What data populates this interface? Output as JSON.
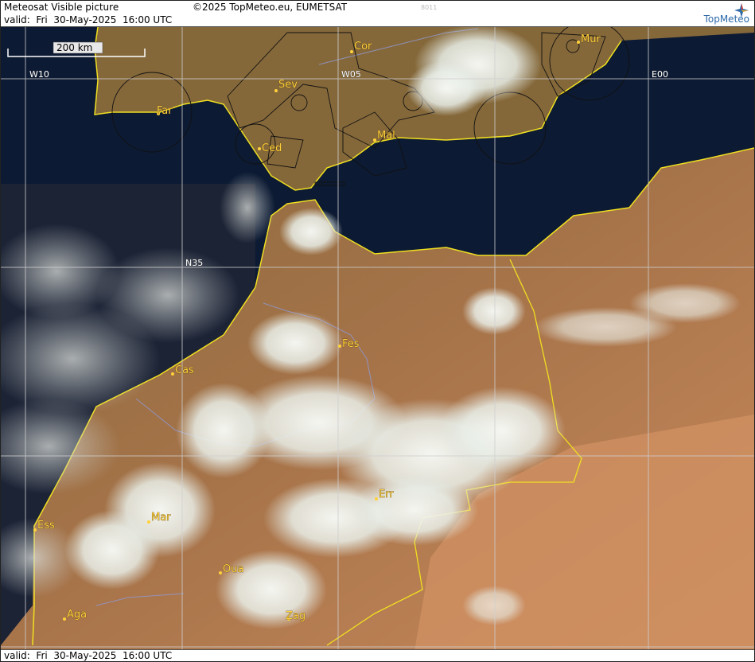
{
  "header": {
    "title": "Meteosat Visible picture",
    "copyright": "©2025 TopMeteo.eu, EUMETSAT",
    "frame_id": "8011",
    "valid": "valid:  Fri  30-May-2025  16:00 UTC",
    "logo": "TopMeteo"
  },
  "footer": {
    "valid": "valid:  Fri  30-May-2025  16:00 UTC"
  },
  "scale": {
    "label": "200 km"
  },
  "grid_labels": {
    "w10": "W10",
    "w05": "W05",
    "e00": "E00",
    "n35": "N35"
  },
  "cities": [
    {
      "name": "Cor"
    },
    {
      "name": "Mur"
    },
    {
      "name": "Sev"
    },
    {
      "name": "Far"
    },
    {
      "name": "Mal"
    },
    {
      "name": "Ced"
    },
    {
      "name": "Fes"
    },
    {
      "name": "Cas"
    },
    {
      "name": "Err"
    },
    {
      "name": "Mar"
    },
    {
      "name": "Ess"
    },
    {
      "name": "Oua"
    },
    {
      "name": "Aga"
    },
    {
      "name": "Zag"
    }
  ],
  "colors": {
    "sea": "#0c1a33",
    "land": "#a87a50",
    "desert": "#c98a5c",
    "coast": "#f0e020",
    "grid": "#cfcfcf",
    "cloud": "#eef3ef",
    "city": "#ffd23a"
  },
  "icons": {
    "logo_icon": "compass-star-icon"
  }
}
